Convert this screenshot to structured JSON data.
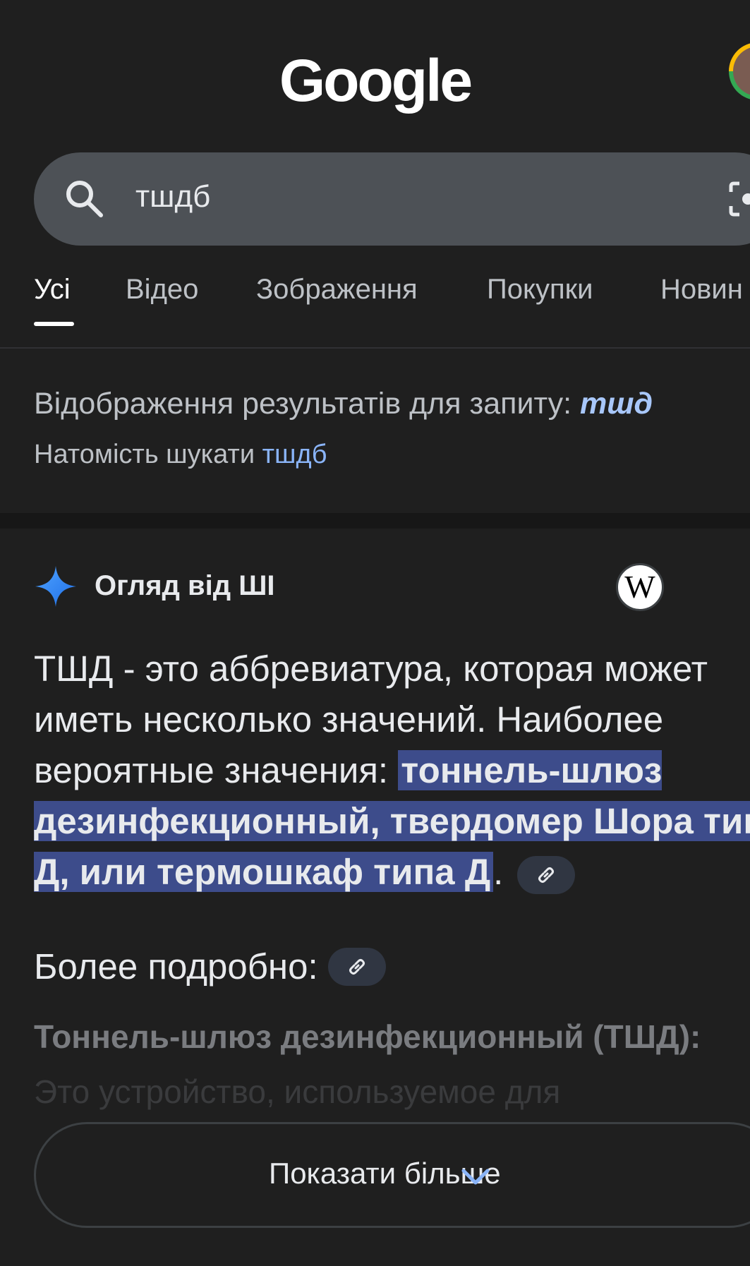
{
  "header": {
    "logo_text": "Google"
  },
  "search": {
    "query": "тшдб"
  },
  "tabs": [
    {
      "label": "Усі",
      "active": true
    },
    {
      "label": "Відео",
      "active": false
    },
    {
      "label": "Зображення",
      "active": false
    },
    {
      "label": "Покупки",
      "active": false
    },
    {
      "label": "Новин",
      "active": false
    }
  ],
  "correction": {
    "prefix": "Відображення результатів для запиту: ",
    "corrected_query": "тшд",
    "instead_prefix": "Натомість шукати ",
    "original_query": "тшдб"
  },
  "ai_overview": {
    "title": "Огляд від ШІ",
    "intro": "ТШД - это аббревиатура, которая может иметь несколько значений. Наиболее вероятные значения: ",
    "highlighted": "тоннель-шлюз дезинфекционный, твердомер Шора типа Д, или термошкаф типа Д",
    "intro_end": ".",
    "more_heading": "Более подробно:",
    "item_title": "Тоннель-шлюз дезинфекционный (ТШД):",
    "item_text": "Это устройство, используемое для",
    "show_more_label": "Показати більше"
  },
  "colors": {
    "background": "#1f1f1f",
    "search_box": "#4d5156",
    "highlight": "#3d4c8b",
    "link": "#8ab4f8",
    "corrected_link": "#a8c7fa"
  },
  "icons": [
    "search-icon",
    "camera-icon",
    "sparkle-icon",
    "wikipedia-icon",
    "link-icon",
    "chevron-down-icon"
  ]
}
